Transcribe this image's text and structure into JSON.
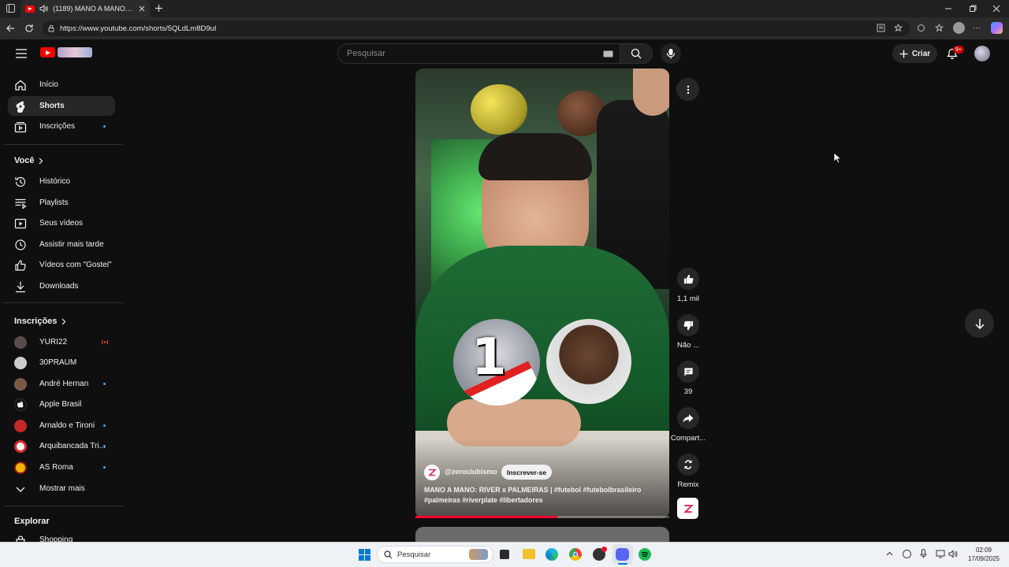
{
  "browser": {
    "tab_title": "(1189) MANO A MANO: RIVER x PALMEIRAS",
    "url": "https://www.youtube.com/shorts/5QLdLm8D9uI"
  },
  "header": {
    "search_placeholder": "Pesquisar",
    "create_label": "Criar",
    "notifications_badge": "9+"
  },
  "sidebar": {
    "main": [
      {
        "label": "Início",
        "icon": "home-icon"
      },
      {
        "label": "Shorts",
        "icon": "shorts-icon",
        "active": true
      },
      {
        "label": "Inscrições",
        "icon": "subscriptions-icon",
        "dot": true
      }
    ],
    "voce_title": "Você",
    "voce": [
      {
        "label": "Histórico",
        "icon": "history-icon"
      },
      {
        "label": "Playlists",
        "icon": "playlists-icon"
      },
      {
        "label": "Seus vídeos",
        "icon": "your-videos-icon"
      },
      {
        "label": "Assistir mais tarde",
        "icon": "watch-later-icon"
      },
      {
        "label": "Vídeos com \"Gostei\"",
        "icon": "liked-icon"
      },
      {
        "label": "Downloads",
        "icon": "download-icon"
      }
    ],
    "subs_title": "Inscrições",
    "subs": [
      {
        "label": "YURI22",
        "live": true,
        "color": "#5a4a4a"
      },
      {
        "label": "30PRAUM",
        "color": "#cccccc"
      },
      {
        "label": "André Hernan",
        "dot": true,
        "color": "#7a5a45"
      },
      {
        "label": "Apple Brasil",
        "color": "#111111"
      },
      {
        "label": "Arnaldo e Tironi",
        "dot": true,
        "color": "#c62828"
      },
      {
        "label": "Arquibancada Tri...",
        "dot": true,
        "color": "#d32f2f"
      },
      {
        "label": "AS Roma",
        "dot": true,
        "color": "#8e1b1b"
      }
    ],
    "show_more": "Mostrar mais",
    "explore_title": "Explorar",
    "explore_first": "Shopping"
  },
  "short": {
    "channel": "@zeroclubismo",
    "subscribe": "Inscrever-se",
    "caption": "MANO A MANO: RIVER x PALMEIRAS | #futebol #futebolbrasileiro #palmeiras #riverplate #libertadores",
    "overlay_number": "1",
    "progress": 0.56
  },
  "actions": {
    "likes": "1,1 mil",
    "dislike": "Não ...",
    "comments": "39",
    "share": "Compart...",
    "remix": "Remix"
  },
  "taskbar": {
    "search": "Pesquisar",
    "time": "02:09",
    "date": "17/09/2025"
  }
}
